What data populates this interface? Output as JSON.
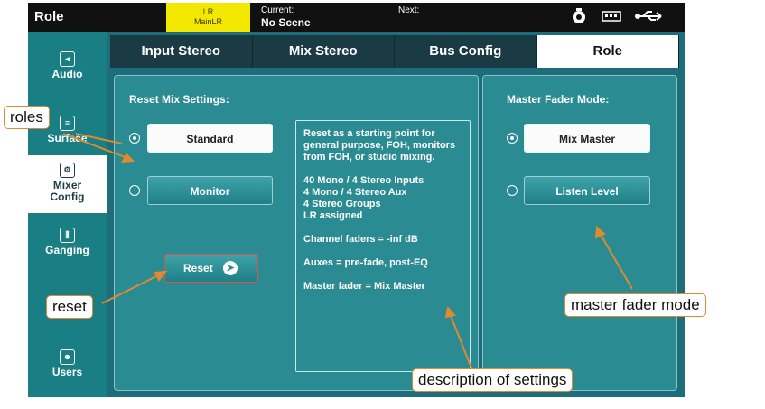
{
  "topbar": {
    "title": "Role",
    "lr_line1": "LR",
    "lr_line2": "MainLR",
    "current_label": "Current:",
    "current_value": "No Scene",
    "next_label": "Next:",
    "icons": [
      "user-usb-icon",
      "keyboard-icon",
      "usb-icon"
    ]
  },
  "sidebar": {
    "items": [
      {
        "label": "Audio",
        "icon": "audio-icon"
      },
      {
        "label": "Surface",
        "icon": "surface-icon"
      },
      {
        "label": "Mixer Config",
        "icon": "mixer-config-icon"
      },
      {
        "label": "Ganging",
        "icon": "ganging-icon"
      },
      {
        "label": "Users",
        "icon": "users-icon"
      }
    ]
  },
  "tabs": [
    "Input Stereo",
    "Mix Stereo",
    "Bus Config",
    "Role"
  ],
  "reset_mix": {
    "title": "Reset Mix Settings:",
    "standard_label": "Standard",
    "monitor_label": "Monitor",
    "reset_label": "Reset"
  },
  "description": {
    "lines": [
      "Reset as a starting point for general purpose, FOH, monitors from FOH, or studio mixing.",
      "40 Mono / 4 Stereo Inputs\n4 Mono / 4 Stereo Aux\n4 Stereo Groups\nLR assigned",
      "Channel faders = -inf dB",
      "Auxes = pre-fade, post-EQ",
      "Master fader = Mix Master"
    ]
  },
  "master_fader": {
    "title": "Master Fader Mode:",
    "mix_master_label": "Mix Master",
    "listen_level_label": "Listen Level"
  },
  "callouts": {
    "roles": "roles",
    "reset": "reset",
    "master_fader_mode": "master fader mode",
    "description_of_settings": "description of settings"
  },
  "colors": {
    "panel": "#2a8b93",
    "sidebar": "#1a7e85",
    "header": "#111111",
    "lr_badge": "#f3e900",
    "callout_border": "#e08a2f"
  }
}
